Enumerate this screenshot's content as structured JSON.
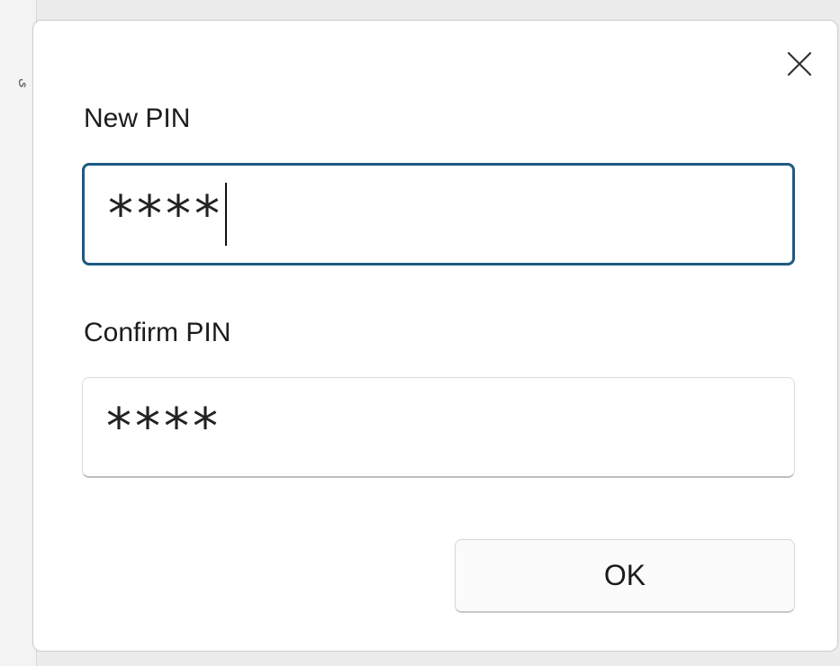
{
  "background": {
    "edge_glyph": "ى"
  },
  "dialog": {
    "close_icon": "close-icon",
    "new_pin": {
      "label": "New PIN",
      "value": "****",
      "focused": true
    },
    "confirm_pin": {
      "label": "Confirm PIN",
      "value": "****"
    },
    "ok_label": "OK"
  },
  "colors": {
    "focus_border": "#1d5a82",
    "dialog_bg": "#ffffff"
  }
}
